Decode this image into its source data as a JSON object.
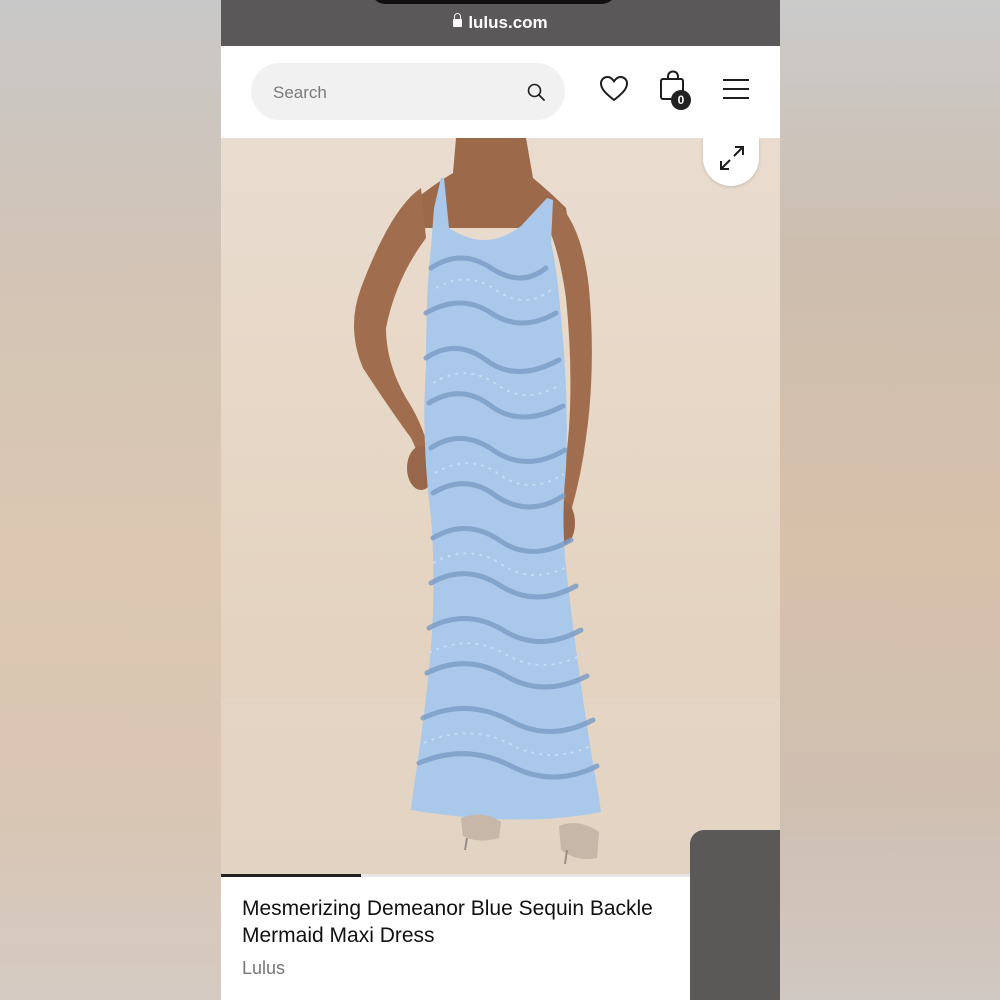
{
  "browser": {
    "url": "lulus.com"
  },
  "header": {
    "search_placeholder": "Search",
    "cart_count": "0",
    "icons": [
      "search-icon",
      "heart-icon",
      "shopping-bag-icon",
      "hamburger-menu-icon"
    ]
  },
  "gallery": {
    "expand_icon": "expand-icon",
    "image_progress": 0.25
  },
  "product": {
    "title": "Mesmerizing Demeanor Blue Sequin Backle",
    "title_line2": "Mermaid Maxi Dress",
    "brand": "Lulus"
  },
  "colors": {
    "dress": "#a9c8ea",
    "url_bar": "#5a5858",
    "badge": "#222222"
  }
}
